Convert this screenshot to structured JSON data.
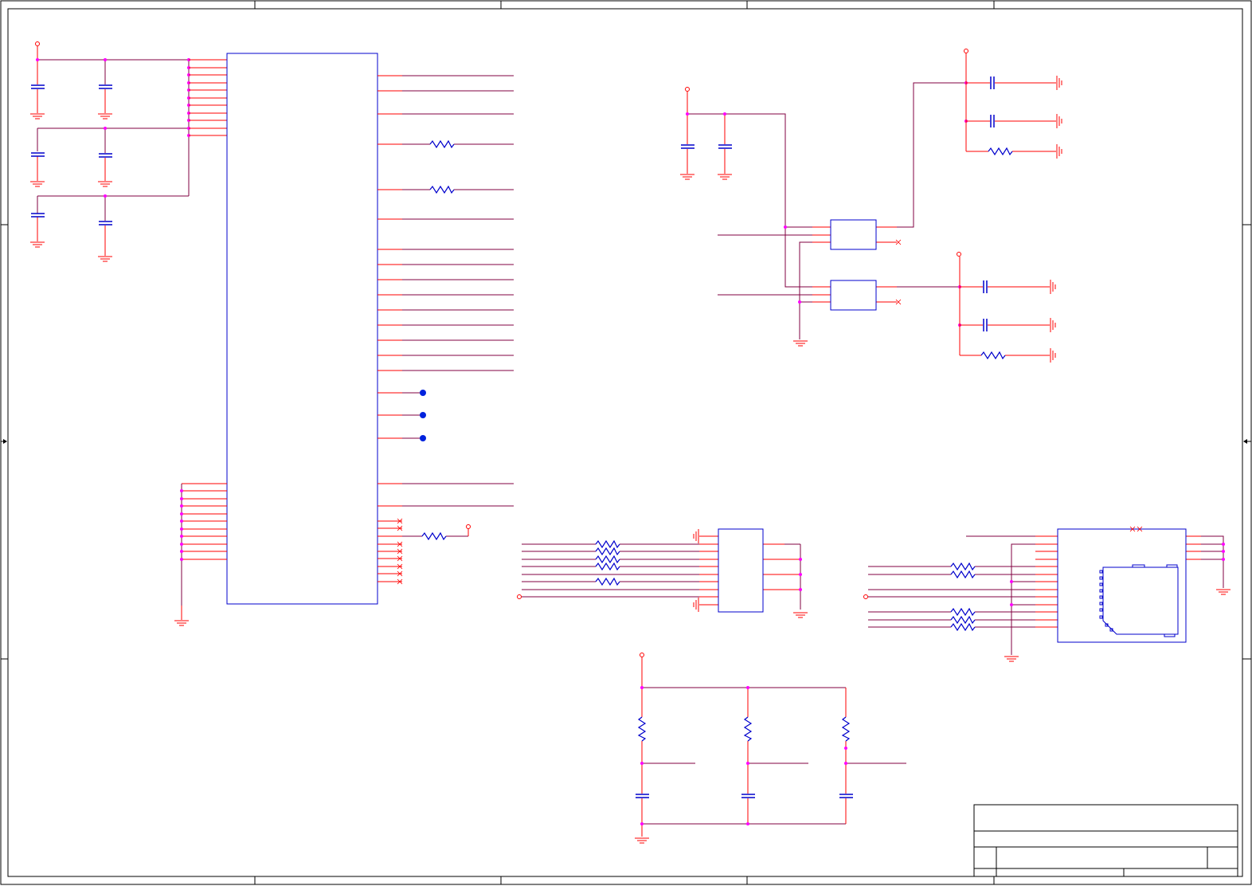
{
  "sheet": {
    "title": "",
    "colors": {
      "border": "#000000",
      "component": "#0000cc",
      "wire": "#800040",
      "pin": "#ff0000",
      "junction": "#ff00ff",
      "dot": "#0022dd"
    }
  },
  "title_block": {
    "title": "",
    "size": "",
    "document_number": "",
    "revision": "",
    "date": "",
    "sheet": ""
  },
  "components": {
    "main_ic": {
      "name": ""
    },
    "regulator_1": {
      "name": ""
    },
    "regulator_2": {
      "name": ""
    },
    "connector_mid": {
      "name": ""
    },
    "sd_card_socket": {
      "name": ""
    }
  }
}
